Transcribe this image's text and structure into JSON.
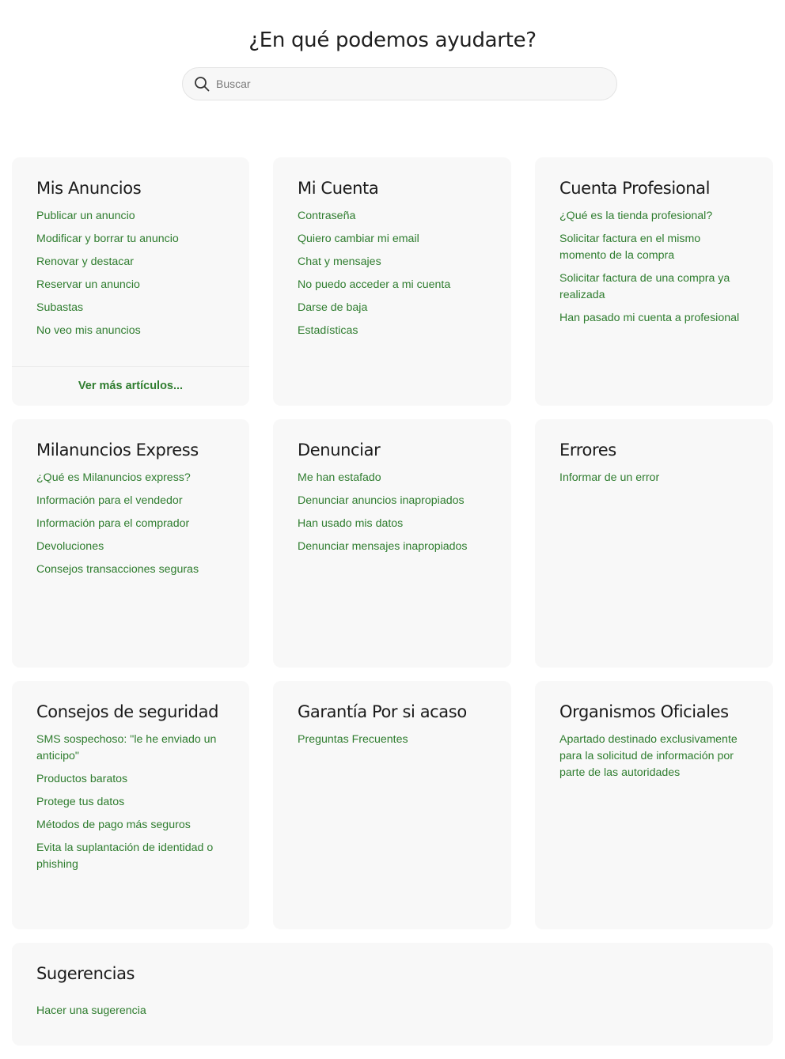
{
  "header": {
    "title": "¿En qué podemos ayudarte?",
    "search_placeholder": "Buscar"
  },
  "colors": {
    "link": "#2f7d2f",
    "card_bg": "#f8f8f8"
  },
  "cards": [
    {
      "title": "Mis Anuncios",
      "links": [
        "Publicar un anuncio",
        "Modificar y borrar tu anuncio",
        "Renovar y destacar",
        "Reservar un anuncio",
        "Subastas",
        "No veo mis anuncios"
      ],
      "more": "Ver más artículos..."
    },
    {
      "title": "Mi Cuenta",
      "links": [
        "Contraseña",
        "Quiero cambiar mi email",
        "Chat y mensajes",
        "No puedo acceder a mi cuenta",
        "Darse de baja",
        "Estadísticas"
      ]
    },
    {
      "title": "Cuenta Profesional",
      "links": [
        "¿Qué es la tienda profesional?",
        "Solicitar factura en el mismo momento de la compra",
        "Solicitar factura de una compra ya realizada",
        "Han pasado mi cuenta a profesional"
      ]
    },
    {
      "title": "Milanuncios Express",
      "links": [
        "¿Qué es Milanuncios express?",
        "Información para el vendedor",
        "Información para el comprador",
        "Devoluciones",
        "Consejos transacciones seguras"
      ]
    },
    {
      "title": "Denunciar",
      "links": [
        "Me han estafado",
        "Denunciar anuncios inapropiados",
        "Han usado mis datos",
        "Denunciar mensajes inapropiados"
      ]
    },
    {
      "title": "Errores",
      "links": [
        "Informar de un error"
      ]
    },
    {
      "title": "Consejos de seguridad",
      "links": [
        "SMS sospechoso: \"le he enviado un anticipo\"",
        "Productos baratos",
        "Protege tus datos",
        "Métodos de pago más seguros",
        "Evita la suplantación de identidad o phishing"
      ]
    },
    {
      "title": "Garantía Por si acaso",
      "links": [
        "Preguntas Frecuentes"
      ]
    },
    {
      "title": "Organismos Oficiales",
      "links": [
        "Apartado destinado exclusivamente para la solicitud de información por parte de las autoridades"
      ]
    },
    {
      "title": "Sugerencias",
      "links": [
        "Hacer una sugerencia"
      ]
    }
  ]
}
